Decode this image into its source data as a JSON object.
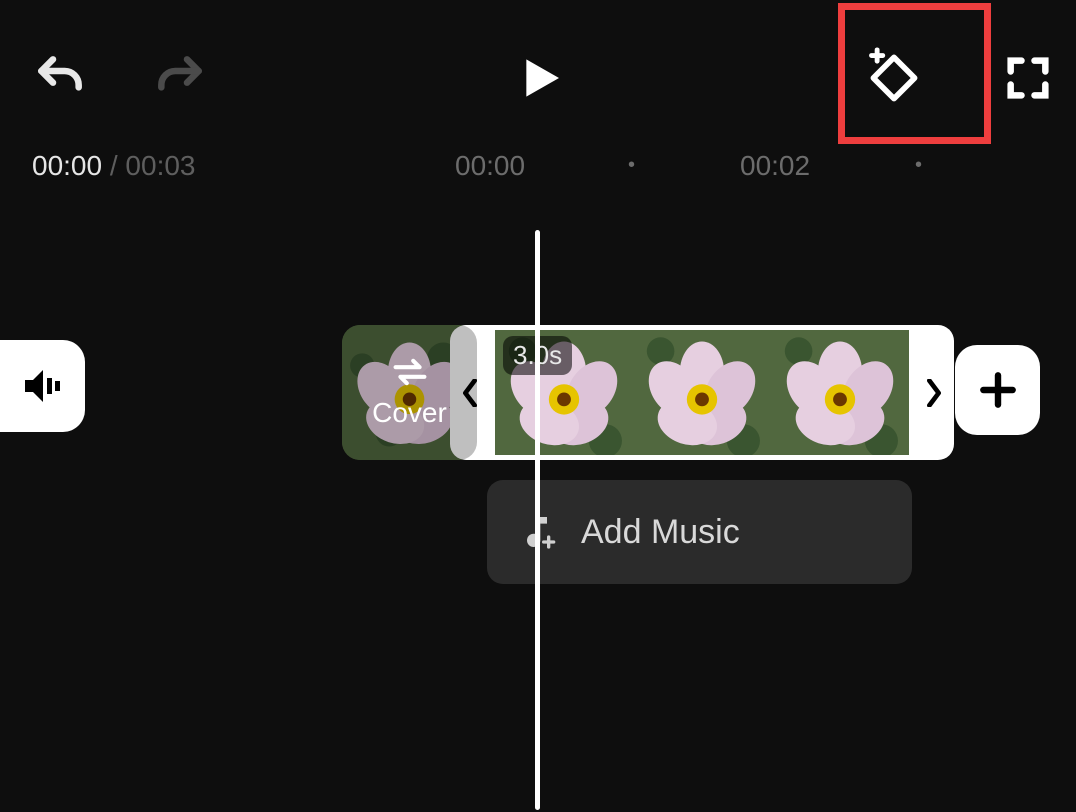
{
  "toolbar": {
    "undo": "undo",
    "redo": "redo",
    "play": "play",
    "keyframe": "keyframe",
    "fullscreen": "fullscreen"
  },
  "time": {
    "current": "00:00",
    "total": "00:03",
    "ticks": [
      "00:00",
      "00:02"
    ]
  },
  "clip": {
    "duration_label": "3.0s",
    "cover_label": "Cover"
  },
  "music": {
    "add_label": "Add Music"
  },
  "icons": {
    "volume": "volume-icon",
    "plus": "plus-icon",
    "swap": "swap-icon",
    "music": "music-note-icon"
  }
}
